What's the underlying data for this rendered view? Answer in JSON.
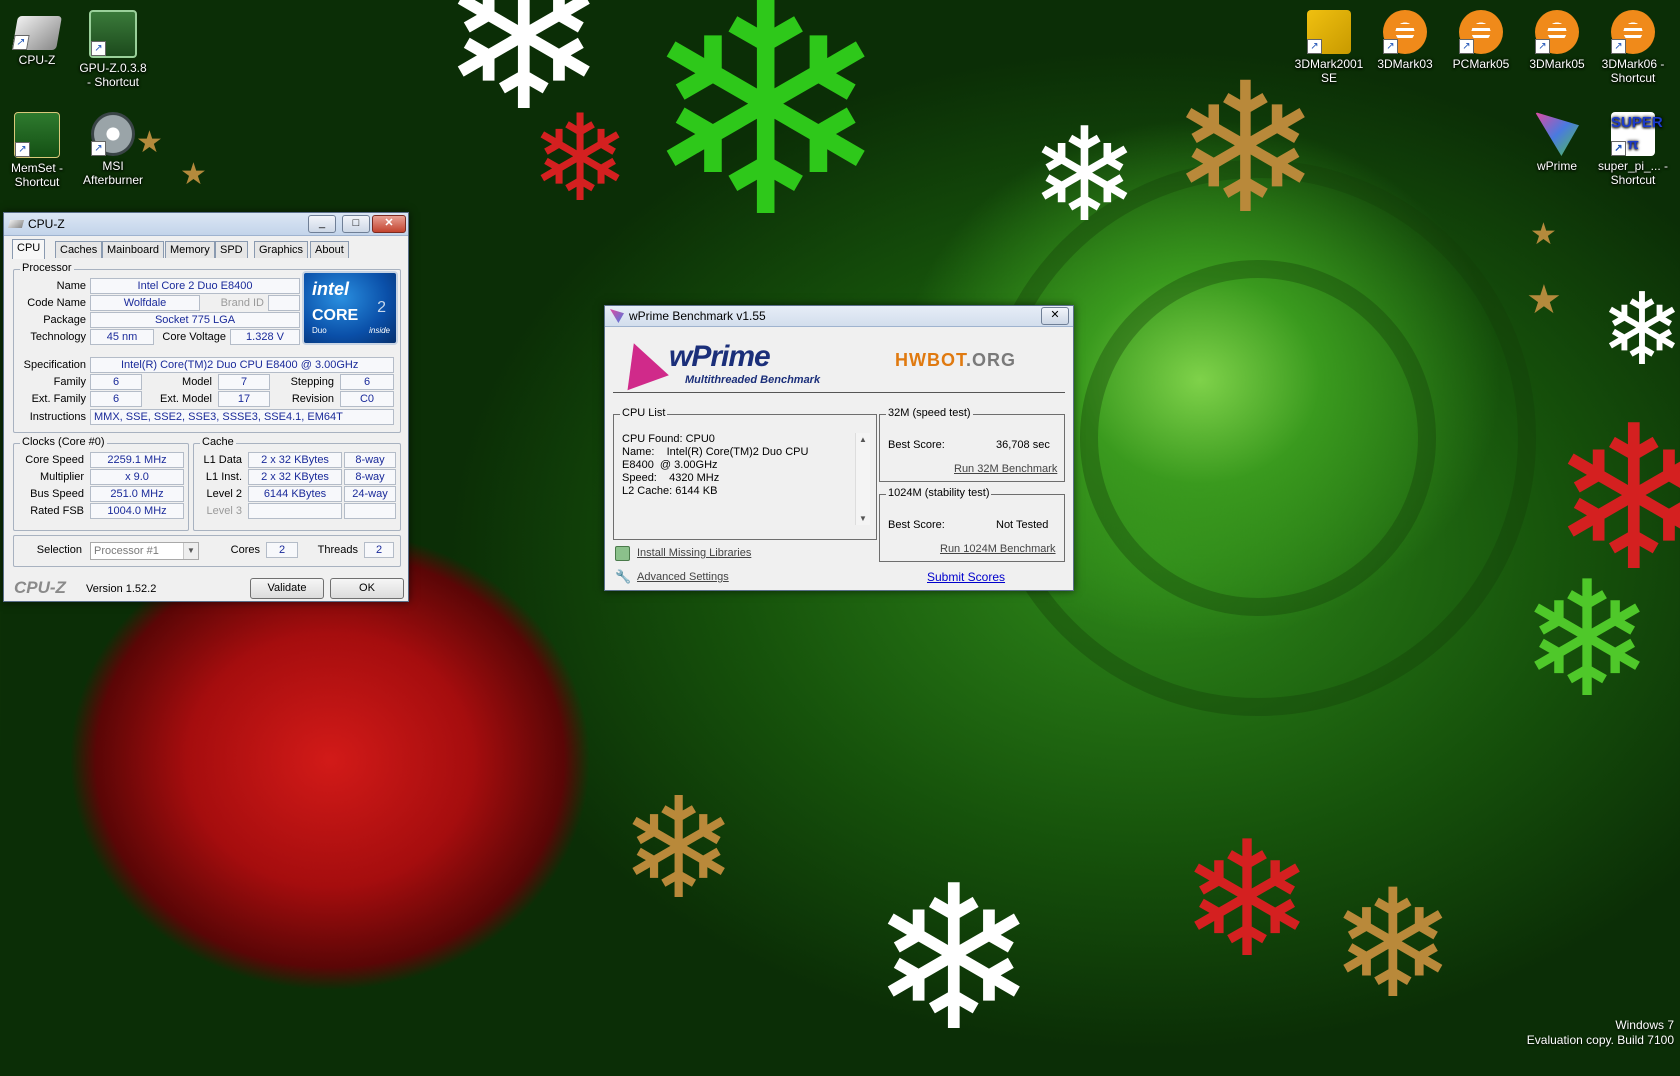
{
  "desktop": {
    "icons_left": [
      {
        "label": "CPU-Z",
        "icon": "cpu-z-icon"
      },
      {
        "label": "GPU-Z.0.3.8 - Shortcut",
        "icon": "gpu-z-icon"
      },
      {
        "label": "MemSet - Shortcut",
        "icon": "memset-icon"
      },
      {
        "label": "MSI Afterburner",
        "icon": "msi-afterburner-icon"
      }
    ],
    "icons_right": [
      {
        "label": "3DMark2001 SE",
        "icon": "3dmark2001-icon"
      },
      {
        "label": "3DMark03",
        "icon": "futuremark-icon"
      },
      {
        "label": "PCMark05",
        "icon": "futuremark-icon"
      },
      {
        "label": "3DMark05",
        "icon": "futuremark-icon"
      },
      {
        "label": "3DMark06 - Shortcut",
        "icon": "futuremark-icon"
      },
      {
        "label": "wPrime",
        "icon": "wprime-icon"
      },
      {
        "label": "super_pi_... - Shortcut",
        "icon": "super-pi-icon"
      }
    ],
    "watermark": {
      "line1": "Windows 7",
      "line2": "Evaluation copy. Build 7100"
    }
  },
  "cpuz": {
    "title": "CPU-Z",
    "tabs": [
      "CPU",
      "Caches",
      "Mainboard",
      "Memory",
      "SPD",
      "Graphics",
      "About"
    ],
    "active_tab": "CPU",
    "processor": {
      "group_title": "Processor",
      "name_label": "Name",
      "name": "Intel Core 2 Duo E8400",
      "codename_label": "Code Name",
      "codename": "Wolfdale",
      "brandid_label": "Brand ID",
      "brandid": "",
      "package_label": "Package",
      "package": "Socket 775 LGA",
      "technology_label": "Technology",
      "technology": "45 nm",
      "corevoltage_label": "Core Voltage",
      "corevoltage": "1.328 V",
      "spec_label": "Specification",
      "spec": "Intel(R) Core(TM)2 Duo CPU     E8400  @ 3.00GHz",
      "family_label": "Family",
      "family": "6",
      "model_label": "Model",
      "model": "7",
      "stepping_label": "Stepping",
      "stepping": "6",
      "extfamily_label": "Ext. Family",
      "extfamily": "6",
      "extmodel_label": "Ext. Model",
      "extmodel": "17",
      "revision_label": "Revision",
      "revision": "C0",
      "instructions_label": "Instructions",
      "instructions": "MMX, SSE, SSE2, SSE3, SSSE3, SSE4.1, EM64T"
    },
    "logo": {
      "brand": "intel",
      "line1": "CORE",
      "line2": "Duo",
      "line3": "inside",
      "digit": "2"
    },
    "clocks": {
      "group_title": "Clocks (Core #0)",
      "corespeed_label": "Core Speed",
      "corespeed": "2259.1 MHz",
      "multiplier_label": "Multiplier",
      "multiplier": "x 9.0",
      "busspeed_label": "Bus Speed",
      "busspeed": "251.0 MHz",
      "ratedfsb_label": "Rated FSB",
      "ratedfsb": "1004.0 MHz"
    },
    "cache": {
      "group_title": "Cache",
      "l1data_label": "L1 Data",
      "l1data": "2 x 32 KBytes",
      "l1data_way": "8-way",
      "l1inst_label": "L1 Inst.",
      "l1inst": "2 x 32 KBytes",
      "l1inst_way": "8-way",
      "level2_label": "Level 2",
      "level2": "6144 KBytes",
      "level2_way": "24-way",
      "level3_label": "Level 3"
    },
    "selection_label": "Selection",
    "selection": "Processor #1",
    "cores_label": "Cores",
    "cores": "2",
    "threads_label": "Threads",
    "threads": "2",
    "brand_text": "CPU-Z",
    "version": "Version 1.52.2",
    "validate_label": "Validate",
    "ok_label": "OK"
  },
  "wprime": {
    "title": "wPrime Benchmark v1.55",
    "logo_text": "wPrime",
    "logo_sub": "Multithreaded Benchmark",
    "hwbot_a": "HWBOT",
    "hwbot_b": ".ORG",
    "cpulist_title": "CPU List",
    "cpulist_text": "CPU Found: CPU0\nName:    Intel(R) Core(TM)2 Duo CPU\nE8400  @ 3.00GHz\nSpeed:    4320 MHz\nL2 Cache: 6144 KB",
    "test32_title": "32M (speed test)",
    "test32_best_label": "Best Score:",
    "test32_best": "36,708 sec",
    "test32_run": "Run 32M Benchmark",
    "test1024_title": "1024M (stability test)",
    "test1024_best_label": "Best Score:",
    "test1024_best": "Not Tested",
    "test1024_run": "Run 1024M Benchmark",
    "install_libs": "Install Missing Libraries",
    "advanced_settings": "Advanced Settings",
    "submit_scores": "Submit Scores"
  }
}
